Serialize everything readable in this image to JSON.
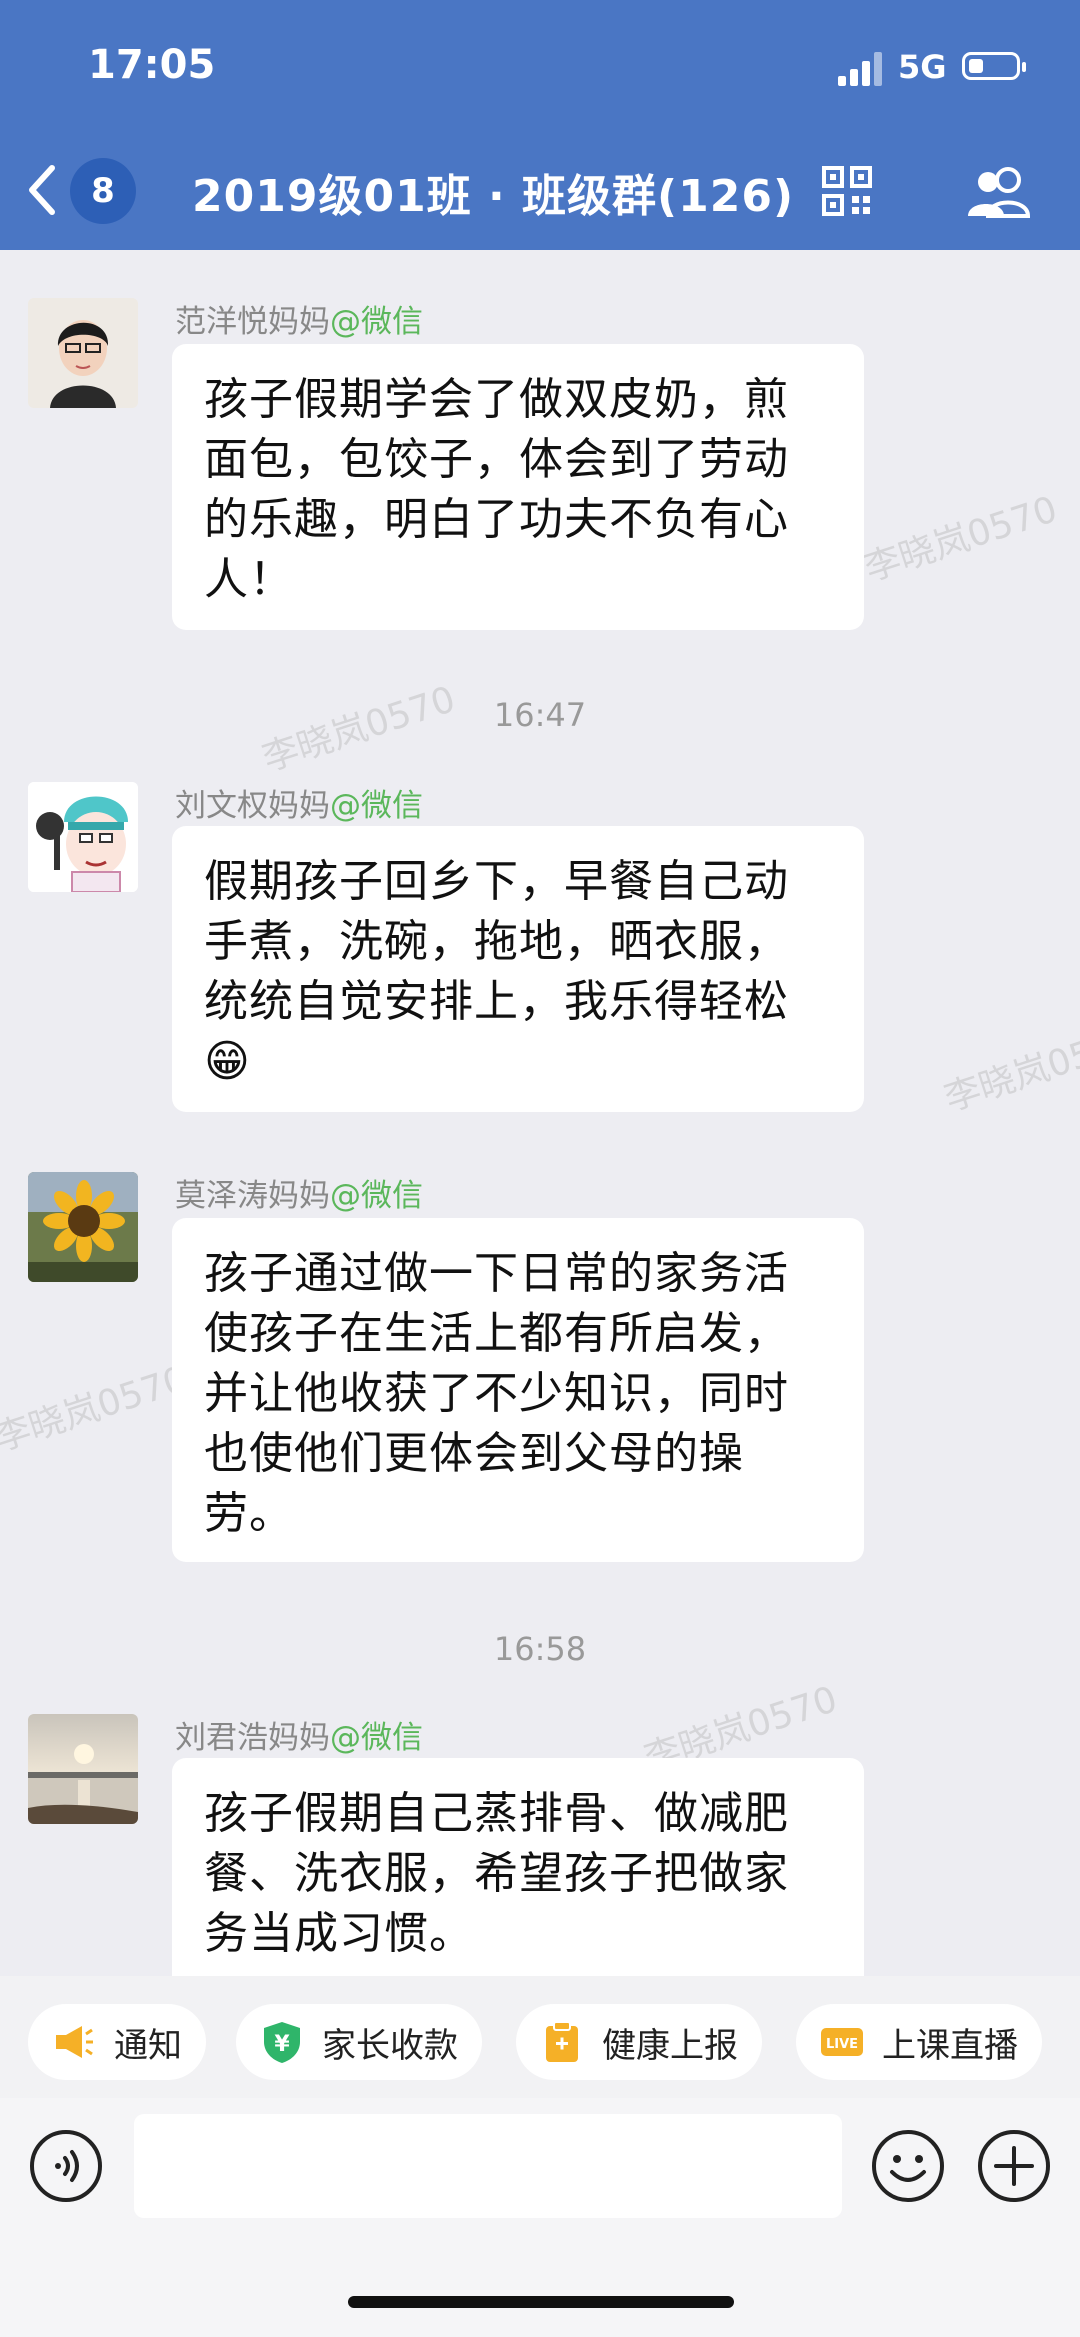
{
  "status_bar": {
    "time": "17:05",
    "network": "5G",
    "battery_level": 0.25
  },
  "header": {
    "back_icon": "chevron-left-icon",
    "badge_count": "8",
    "title": "2019级01班 · 班级群(126)",
    "qr_icon": "qr-code-icon",
    "members_icon": "group-members-icon"
  },
  "watermark": "李晓岚0570",
  "messages": [
    {
      "sender": "范洋悦妈妈",
      "source": "@微信",
      "avatar": "woman-portrait-avatar",
      "lines": [
        "孩子假期学会了做双皮奶，煎",
        "面包，包饺子，体会到了劳动",
        "的乐趣，明白了功夫不负有心",
        "人！"
      ]
    },
    {
      "sender": "刘文权妈妈",
      "source": "@微信",
      "avatar": "cartoon-helmet-avatar",
      "lines": [
        "假期孩子回乡下，早餐自己动",
        "手煮，洗碗，拖地，晒衣服，",
        "统统自觉安排上，我乐得轻松"
      ],
      "emoji": "😁"
    },
    {
      "sender": "莫泽涛妈妈",
      "source": "@微信",
      "avatar": "sunflower-avatar",
      "lines": [
        "孩子通过做一下日常的家务活",
        "使孩子在生活上都有所启发，",
        "并让他收获了不少知识，同时",
        "也使他们更体会到父母的操",
        "劳。"
      ]
    },
    {
      "sender": "刘君浩妈妈",
      "source": "@微信",
      "avatar": "sunset-lake-avatar",
      "lines": [
        "孩子假期自己蒸排骨、做减肥",
        "餐、洗衣服，希望孩子把做家",
        "务当成习惯。"
      ]
    }
  ],
  "time_dividers": [
    "16:47",
    "16:58"
  ],
  "quick_actions": [
    {
      "label": "通知",
      "icon": "megaphone-icon",
      "color": "#f5b027"
    },
    {
      "label": "家长收款",
      "icon": "yuan-shield-icon",
      "color": "#2fb56a"
    },
    {
      "label": "健康上报",
      "icon": "clipboard-icon",
      "color": "#f5b027"
    },
    {
      "label": "上课直播",
      "icon": "live-icon",
      "color": "#f5b027"
    }
  ],
  "input_bar": {
    "placeholder": "",
    "voice_icon": "voice-icon",
    "emoji_icon": "emoji-icon",
    "plus_icon": "plus-icon"
  }
}
